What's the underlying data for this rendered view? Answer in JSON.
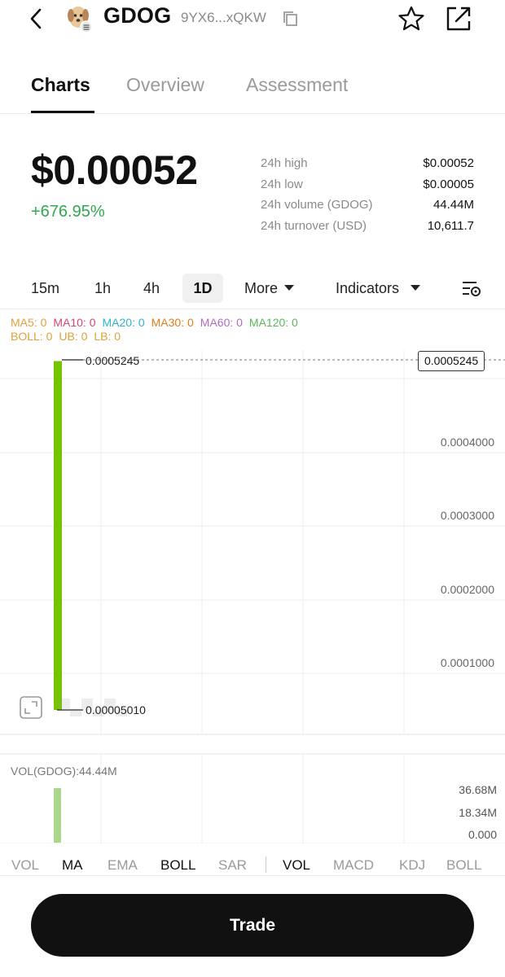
{
  "header": {
    "token_name": "GDOG",
    "address_short": "9YX6...xQKW",
    "icons": [
      "back-icon",
      "token-dog-icon",
      "copy-icon",
      "star-icon",
      "share-icon"
    ]
  },
  "tabs": [
    {
      "label": "Charts",
      "active": true
    },
    {
      "label": "Overview",
      "active": false
    },
    {
      "label": "Assessment",
      "active": false
    }
  ],
  "price": {
    "value": "$0.00052",
    "change": "+676.95%",
    "change_color": "#2fa84f"
  },
  "stats": [
    {
      "label": "24h high",
      "value": "$0.00052"
    },
    {
      "label": "24h low",
      "value": "$0.00005"
    },
    {
      "label": "24h volume (GDOG)",
      "value": "44.44M"
    },
    {
      "label": "24h turnover (USD)",
      "value": "10,611.7"
    }
  ],
  "timeframes": {
    "items": [
      "15m",
      "1h",
      "4h",
      "1D"
    ],
    "active": "1D",
    "more": "More",
    "indicators": "Indicators"
  },
  "ma_legend": {
    "row1": [
      {
        "label": "MA5: 0",
        "color": "#e0a03a"
      },
      {
        "label": "MA10: 0",
        "color": "#d6457a"
      },
      {
        "label": "MA20: 0",
        "color": "#2fb3cf"
      },
      {
        "label": "MA30: 0",
        "color": "#e07b1f"
      },
      {
        "label": "MA60: 0",
        "color": "#b06cc2"
      },
      {
        "label": "MA120: 0",
        "color": "#5cb85c"
      }
    ],
    "row2": [
      {
        "label": "BOLL: 0",
        "color": "#e0a03a"
      },
      {
        "label": "UB: 0",
        "color": "#e0a03a"
      },
      {
        "label": "LB: 0",
        "color": "#e0a03a"
      }
    ]
  },
  "chart": {
    "current_price_tag": "0.0005245",
    "high_label": "0.0005245",
    "low_label": "0.00005010",
    "y_labels": [
      "0.0004000",
      "0.0003000",
      "0.0002000",
      "0.0001000"
    ],
    "candle_color": "#76c400"
  },
  "chart_data": {
    "type": "candlestick",
    "candles": [
      {
        "open": 5.01e-05,
        "close": 0.0005245,
        "high": 0.0005245,
        "low": 5.01e-05
      }
    ],
    "yticks": [
      0.0004,
      0.0003,
      0.0002,
      0.0001
    ],
    "ylim": [
      0,
      0.0005245
    ],
    "volume": {
      "label": "VOL(GDOG):44.44M",
      "values": [
        44.44
      ],
      "ticks": [
        "36.68M",
        "18.34M",
        "0.000"
      ]
    }
  },
  "indicator_bar": {
    "main": [
      {
        "label": "VOL",
        "on": false
      },
      {
        "label": "MA",
        "on": true
      },
      {
        "label": "EMA",
        "on": false
      },
      {
        "label": "BOLL",
        "on": true
      },
      {
        "label": "SAR",
        "on": false
      }
    ],
    "sub": [
      {
        "label": "VOL",
        "on": true
      },
      {
        "label": "MACD",
        "on": false
      },
      {
        "label": "KDJ",
        "on": false
      },
      {
        "label": "BOLL",
        "on": false
      }
    ]
  },
  "trade_button": "Trade"
}
